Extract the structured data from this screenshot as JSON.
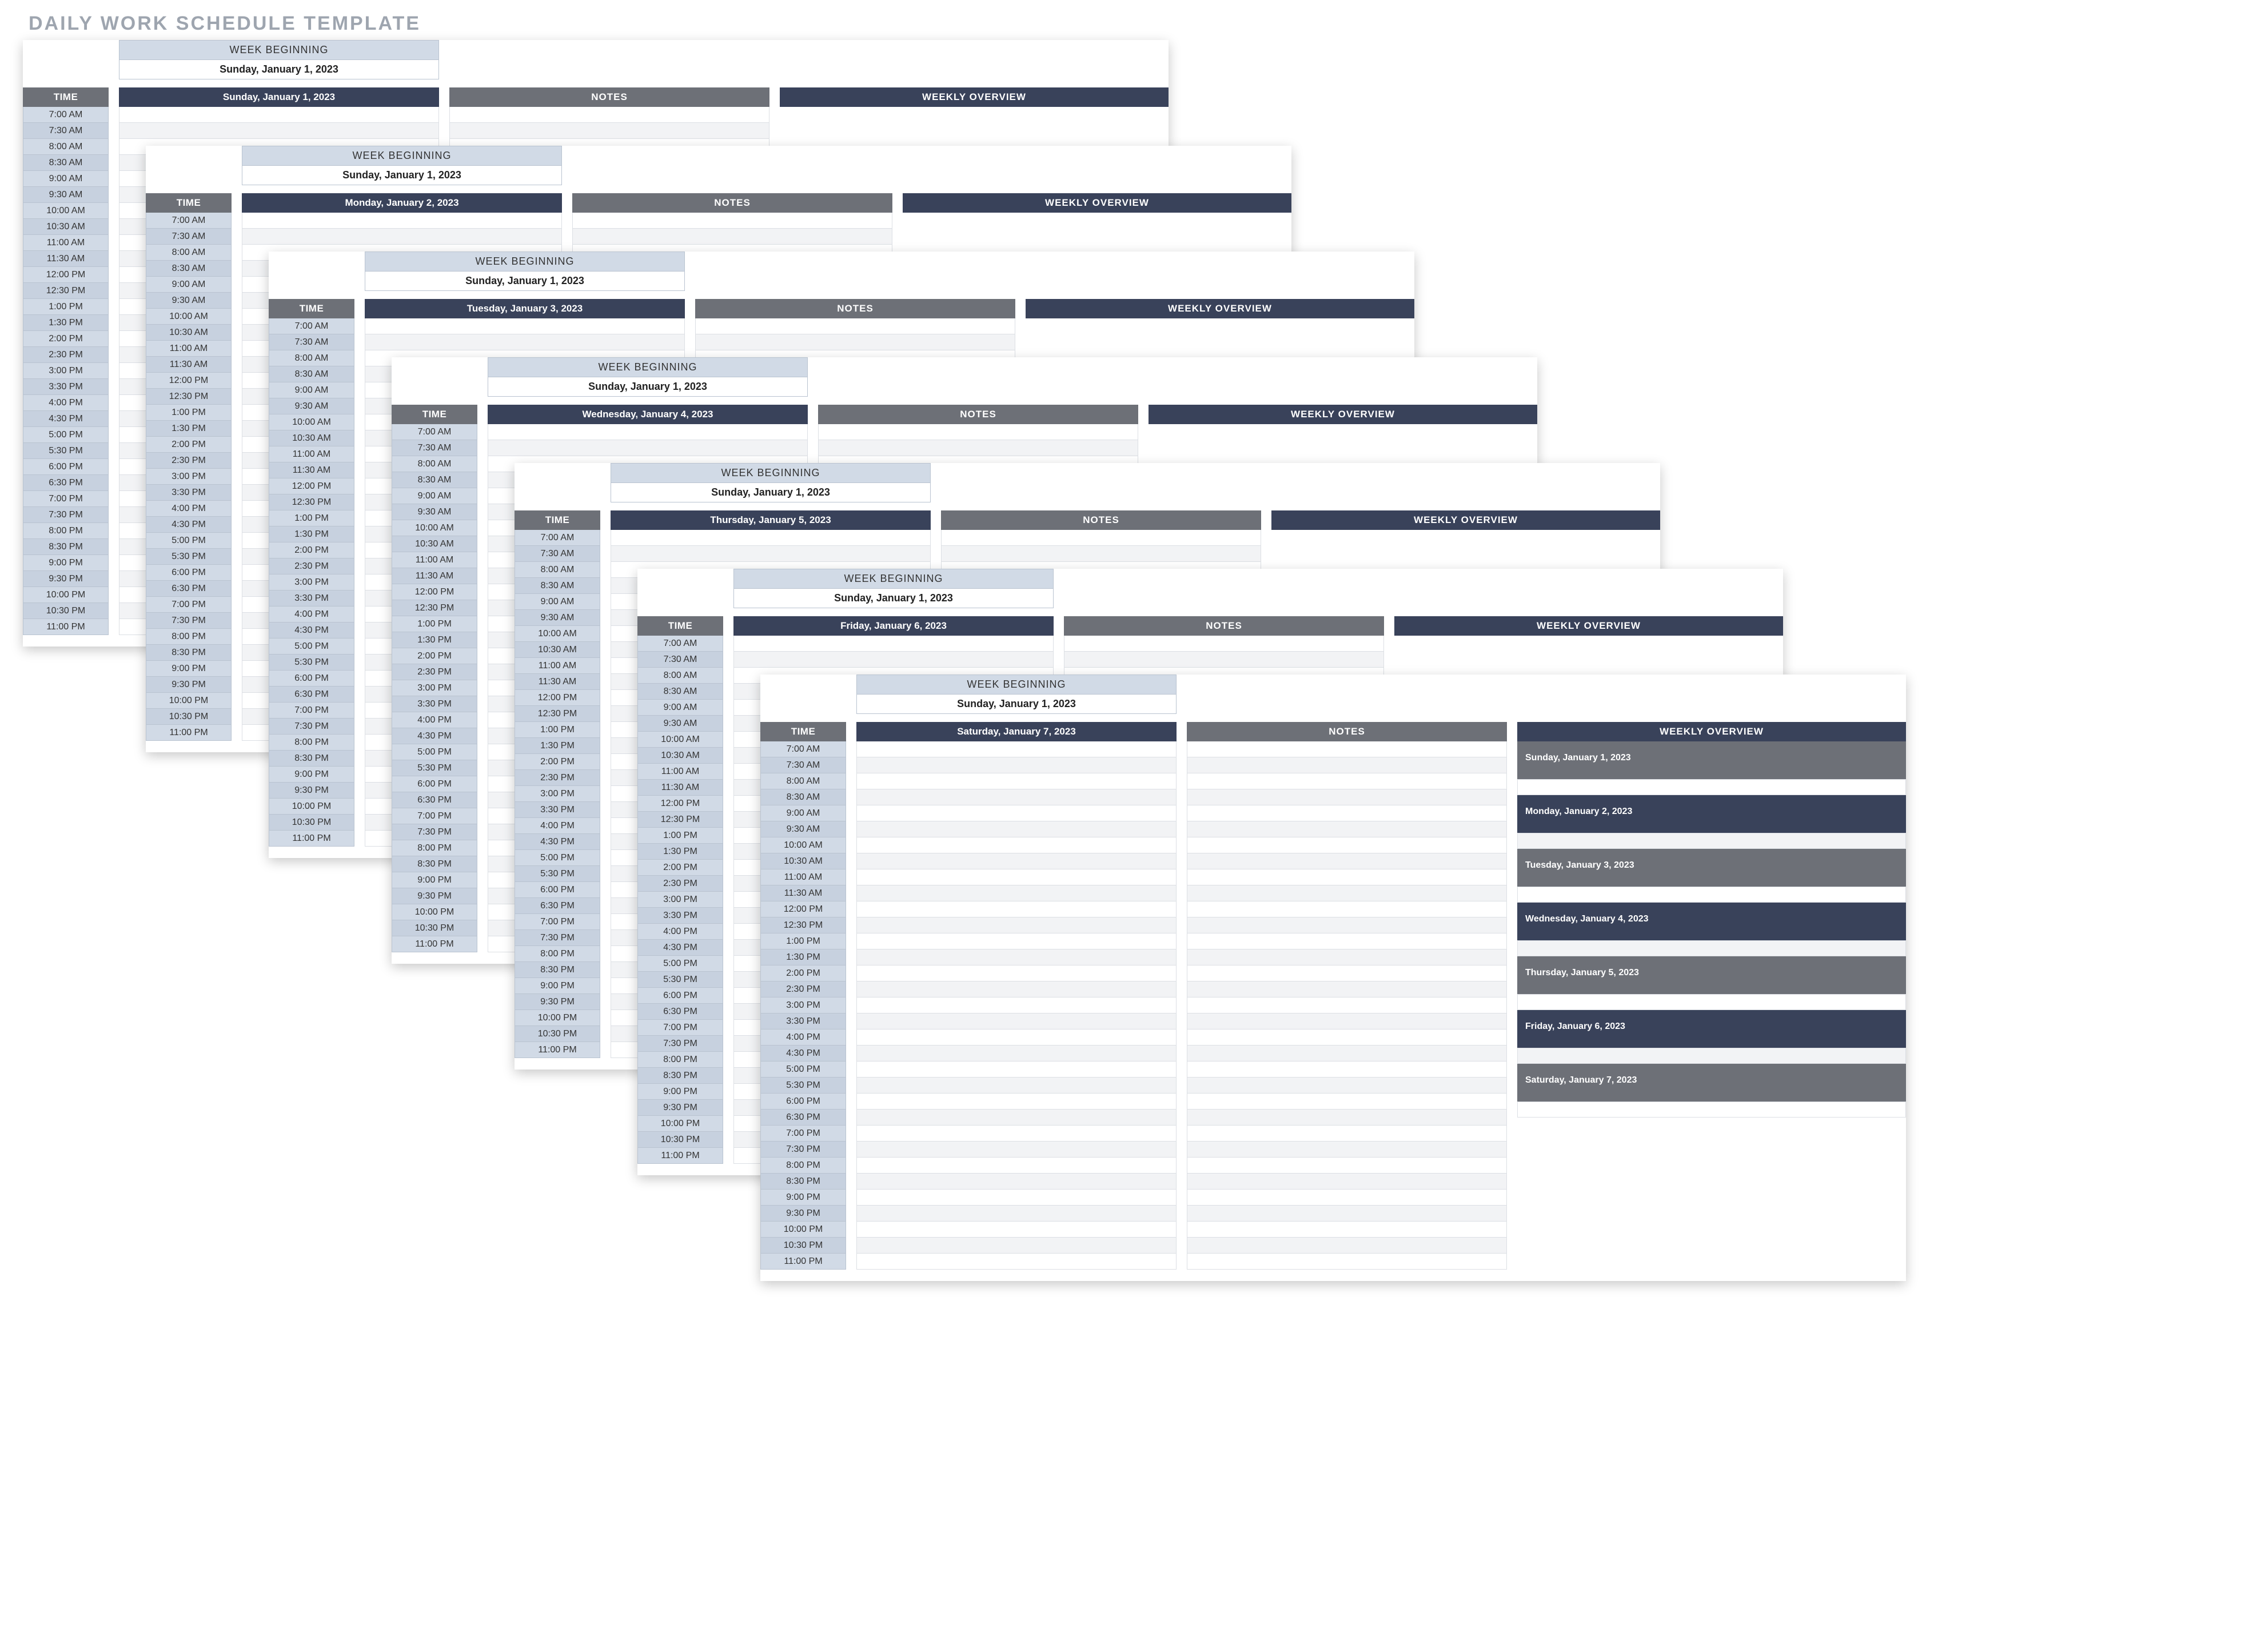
{
  "page_title": "DAILY WORK SCHEDULE TEMPLATE",
  "week_beginning_label": "WEEK BEGINNING",
  "week_beginning_value": "Sunday, January 1, 2023",
  "headers": {
    "time": "TIME",
    "notes": "NOTES",
    "weekly_overview": "WEEKLY OVERVIEW"
  },
  "time_slots": [
    "7:00 AM",
    "7:30 AM",
    "8:00 AM",
    "8:30 AM",
    "9:00 AM",
    "9:30 AM",
    "10:00 AM",
    "10:30 AM",
    "11:00 AM",
    "11:30 AM",
    "12:00 PM",
    "12:30 PM",
    "1:00 PM",
    "1:30 PM",
    "2:00 PM",
    "2:30 PM",
    "3:00 PM",
    "3:30 PM",
    "4:00 PM",
    "4:30 PM",
    "5:00 PM",
    "5:30 PM",
    "6:00 PM",
    "6:30 PM",
    "7:00 PM",
    "7:30 PM",
    "8:00 PM",
    "8:30 PM",
    "9:00 PM",
    "9:30 PM",
    "10:00 PM",
    "10:30 PM",
    "11:00 PM"
  ],
  "sheets": [
    {
      "date_header": "Sunday, January 1, 2023",
      "show_overview": false
    },
    {
      "date_header": "Monday, January 2, 2023",
      "show_overview": false
    },
    {
      "date_header": "Tuesday, January 3, 2023",
      "show_overview": false
    },
    {
      "date_header": "Wednesday, January 4, 2023",
      "show_overview": false
    },
    {
      "date_header": "Thursday, January 5, 2023",
      "show_overview": false
    },
    {
      "date_header": "Friday, January 6, 2023",
      "show_overview": false
    },
    {
      "date_header": "Saturday, January 7, 2023",
      "show_overview": true
    }
  ],
  "overview_days": [
    "Sunday, January 1, 2023",
    "Monday, January 2, 2023",
    "Tuesday, January 3, 2023",
    "Wednesday, January 4, 2023",
    "Thursday, January 5, 2023",
    "Friday, January 6, 2023",
    "Saturday, January 7, 2023"
  ]
}
